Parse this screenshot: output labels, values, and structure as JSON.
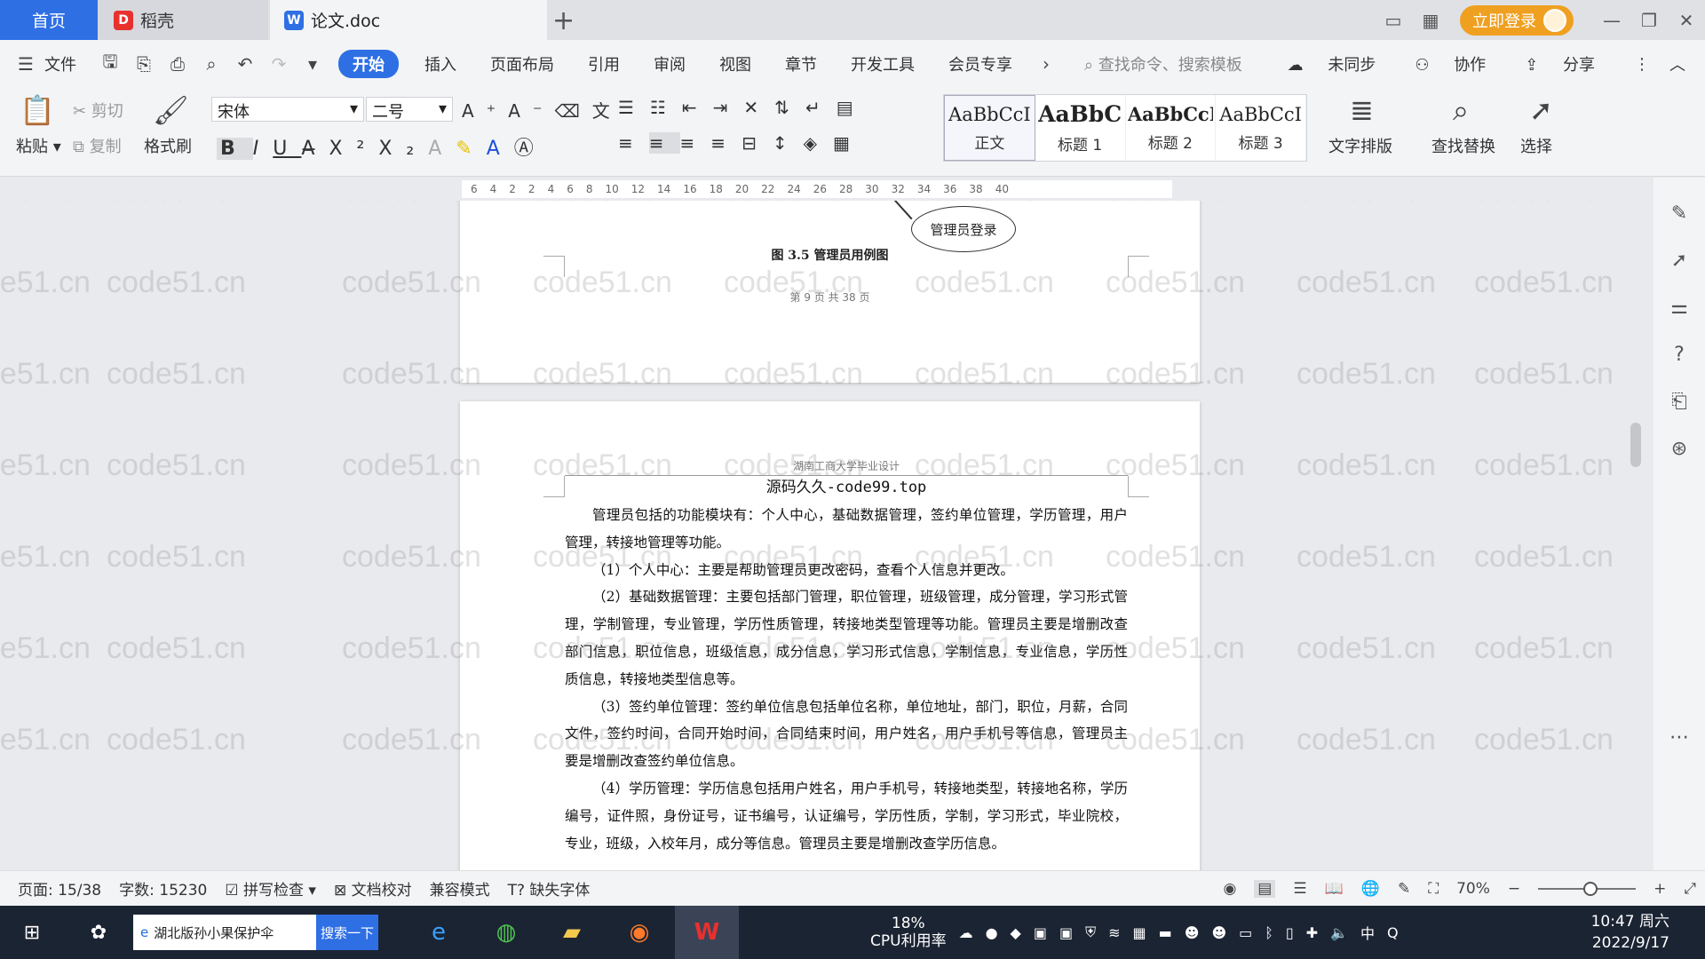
{
  "tabs": [
    {
      "label": "首页"
    },
    {
      "label": "稻壳"
    },
    {
      "label": "论文.doc"
    }
  ],
  "titlebar": {
    "login": "立即登录"
  },
  "menu": {
    "file": "文件",
    "items": [
      "开始",
      "插入",
      "页面布局",
      "引用",
      "审阅",
      "视图",
      "章节",
      "开发工具",
      "会员专享"
    ],
    "search": "查找命令、搜索模板",
    "sync": "未同步",
    "collab": "协作",
    "share": "分享"
  },
  "ribbon": {
    "paste": "粘贴",
    "cut": "剪切",
    "copy": "复制",
    "format_painter": "格式刷",
    "font": "宋体",
    "size": "二号",
    "styles": [
      {
        "sample": "AaBbCcI",
        "name": "正文"
      },
      {
        "sample": "AaBbC",
        "name": "标题 1"
      },
      {
        "sample": "AaBbCcI",
        "name": "标题 2"
      },
      {
        "sample": "AaBbCcI",
        "name": "标题 3"
      }
    ],
    "text_layout": "文字排版",
    "find_replace": "查找替换",
    "select": "选择"
  },
  "ruler": {
    "ticks": [
      "6",
      "4",
      "2",
      "2",
      "4",
      "6",
      "8",
      "10",
      "12",
      "14",
      "16",
      "18",
      "20",
      "22",
      "24",
      "26",
      "28",
      "30",
      "32",
      "34",
      "36",
      "38",
      "40"
    ]
  },
  "page1": {
    "ellipse_label": "管理员登录",
    "caption": "图 3.5 管理员用例图",
    "page_number": "第 9 页 共 38 页"
  },
  "page2": {
    "header": "湖南工商大学毕业设计",
    "header_mark": "源码久久-code99.top",
    "paragraphs": [
      "管理员包括的功能模块有：个人中心，基础数据管理，签约单位管理，学历管理，用户管理，转接地管理等功能。",
      "（1）个人中心：主要是帮助管理员更改密码，查看个人信息并更改。",
      "（2）基础数据管理：主要包括部门管理，职位管理，班级管理，成分管理，学习形式管理，学制管理，专业管理，学历性质管理，转接地类型管理等功能。管理员主要是增删改查部门信息，职位信息，班级信息，成分信息，学习形式信息，学制信息，专业信息，学历性质信息，转接地类型信息等。",
      "（3）签约单位管理：签约单位信息包括单位名称，单位地址，部门，职位，月薪，合同文件，签约时间，合同开始时间，合同结束时间，用户姓名，用户手机号等信息，管理员主要是增删改查签约单位信息。",
      "（4）学历管理：学历信息包括用户姓名，用户手机号，转接地类型，转接地名称，学历编号，证件照，身份证号，证书编号，认证编号，学历性质，学制，学习形式，毕业院校，专业，班级，入校年月，成分等信息。管理员主要是增删改查学历信息。"
    ]
  },
  "watermark": "code51.cn",
  "status": {
    "page": "页面: 15/38",
    "words": "字数: 15230",
    "spell": "拼写检查",
    "proof": "文档校对",
    "compat": "兼容模式",
    "missing_font": "缺失字体",
    "zoom": "70%",
    "zoom_level": 0.7
  },
  "taskbar": {
    "search_text": "湖北版孙小果保护伞",
    "search_btn": "搜索一下",
    "cpu_pct": "18%",
    "cpu_label": "CPU利用率",
    "ime": "中",
    "time": "10:47 周六",
    "date": "2022/9/17"
  }
}
